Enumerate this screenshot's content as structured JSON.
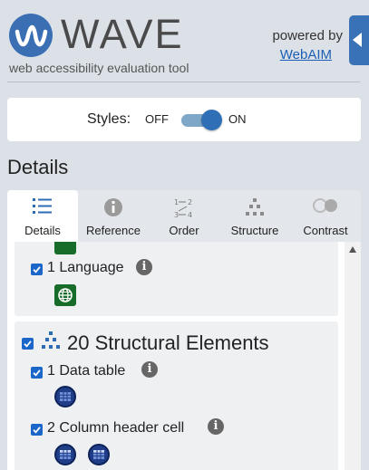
{
  "header": {
    "logo_text": "WAVE",
    "tagline": "web accessibility evaluation tool",
    "powered_by": "powered by",
    "powered_link": "WebAIM"
  },
  "styles_toggle": {
    "label": "Styles:",
    "off": "OFF",
    "on": "ON",
    "state": "on"
  },
  "section_title": "Details",
  "tabs": [
    {
      "label": "Details",
      "icon": "details-list-icon",
      "active": true
    },
    {
      "label": "Reference",
      "icon": "info-icon",
      "active": false
    },
    {
      "label": "Order",
      "icon": "order-icon",
      "active": false
    },
    {
      "label": "Structure",
      "icon": "structure-tree-icon",
      "active": false
    },
    {
      "label": "Contrast",
      "icon": "contrast-icon",
      "active": false
    }
  ],
  "panel": {
    "language": {
      "count_label": "1 Language",
      "checked": true,
      "icon": "globe-icon"
    },
    "structural": {
      "heading": "20 Structural Elements",
      "checked": true,
      "items": [
        {
          "label": "1 Data table",
          "checked": true,
          "icon_count": 1,
          "icon": "table-icon"
        },
        {
          "label": "2 Column header cell",
          "checked": true,
          "icon_count": 2,
          "icon": "table-header-icon"
        }
      ]
    }
  },
  "colors": {
    "brand_blue": "#3a6fb4",
    "checkbox_blue": "#1a66c9",
    "feature_green": "#176c2a",
    "structure_navy": "#1f3d88",
    "background": "#dce1e8"
  }
}
